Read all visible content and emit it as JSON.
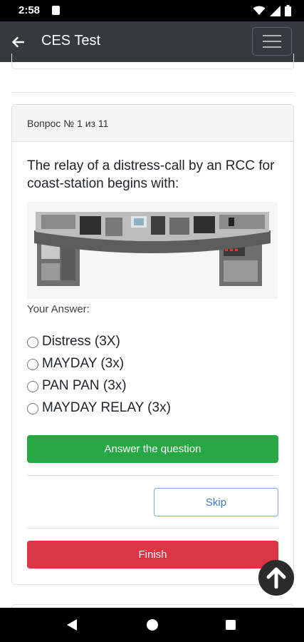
{
  "status_bar": {
    "time": "2:58"
  },
  "app_bar": {
    "title": "CES Test"
  },
  "card": {
    "header": "Вопрос № 1 из 11",
    "question": "The relay of a distress-call by an RCC for coast-station begins with:",
    "answer_label": "Your Answer:",
    "options": [
      {
        "label": "Distress (3X)"
      },
      {
        "label": "MAYDAY (3x)"
      },
      {
        "label": "PAN PAN (3x)"
      },
      {
        "label": "MAYDAY RELAY (3x)"
      }
    ],
    "answer_button": "Answer the question",
    "skip_button": "Skip",
    "finish_button": "Finish"
  },
  "colors": {
    "app_bar": "#343a40",
    "answer_button": "#28a745",
    "skip_border": "#7da7e0",
    "finish_button": "#dc3545"
  },
  "icons": [
    "back-arrow-icon",
    "hamburger-menu-icon",
    "arrow-up-icon",
    "wifi-icon",
    "signal-icon",
    "battery-icon"
  ]
}
